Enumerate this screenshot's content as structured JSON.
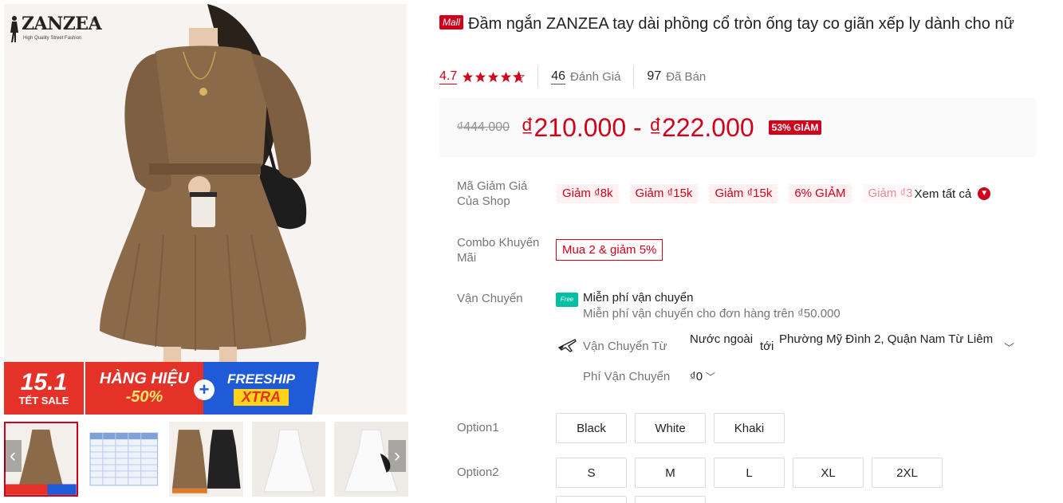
{
  "brand": {
    "logo_text": "ZANZEA",
    "logo_tagline": "High Quality Street Fashion",
    "logo_reg": "®"
  },
  "banner": {
    "date": "15.1",
    "date_sub": "TẾT SALE",
    "mid_line1": "HÀNG HIỆU",
    "mid_line2": "-50%",
    "plus": "+",
    "free_line1": "FREESHIP",
    "free_line2": "XTRA"
  },
  "gallery": {
    "prev_arrow": "‹",
    "next_arrow": "›",
    "thumbnails": [
      "thumb-1",
      "thumb-2",
      "thumb-3",
      "thumb-4",
      "thumb-5"
    ]
  },
  "product": {
    "mall_badge": "Mall",
    "title": "Đầm ngắn ZANZEA tay dài phồng cổ tròn ống tay co giãn xếp ly dành cho nữ",
    "rating": "4.7",
    "stars_filled": 4.7,
    "reviews_count": "46",
    "reviews_label": "Đánh Giá",
    "sold_count": "97",
    "sold_label": "Đã Bán"
  },
  "price": {
    "original": "₫444.000",
    "range": "₫210.000 - ₫222.000",
    "discount": "53% GIẢM"
  },
  "vouchers": {
    "label": "Mã Giảm Giá Của Shop",
    "items": [
      "Giảm ₫8k",
      "Giảm ₫15k",
      "Giảm ₫15k",
      "6% GIẢM",
      "Giảm ₫3"
    ],
    "see_all": "Xem tất cả"
  },
  "combo": {
    "label": "Combo Khuyến Mãi",
    "value": "Mua 2 & giảm 5%"
  },
  "shipping": {
    "label": "Vận Chuyển",
    "free_icon": "Free",
    "free_title": "Miễn phí vận chuyển",
    "free_sub": "Miễn phí vận chuyển cho đơn hàng trên ₫50.000",
    "from_label": "Vận Chuyển Từ",
    "origin": "Nước ngoài",
    "to": "tới",
    "destination": "Phường Mỹ Đình 2, Quận Nam Từ Liêm",
    "fee_label": "Phí Vận Chuyển",
    "fee_value": "₫0"
  },
  "option1": {
    "label": "Option1",
    "values": [
      "Black",
      "White",
      "Khaki"
    ]
  },
  "option2": {
    "label": "Option2",
    "values": [
      "S",
      "M",
      "L",
      "XL",
      "2XL"
    ]
  },
  "colors": {
    "accent": "#d0011b",
    "price_bg": "#fafafa",
    "voucher_bg": "#fff0f1",
    "dress": "#8b6a4a"
  }
}
